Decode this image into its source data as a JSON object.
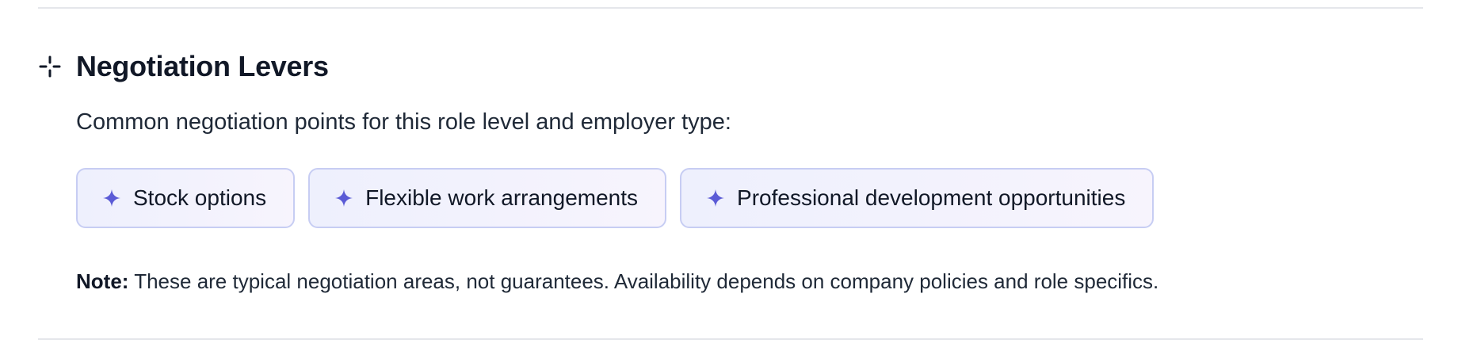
{
  "section": {
    "icon": "negotiation-levers-icon",
    "title": "Negotiation Levers",
    "subtitle": "Common negotiation points for this role level and employer type:"
  },
  "levers": [
    {
      "label": "Stock options",
      "icon": "sparkle-icon"
    },
    {
      "label": "Flexible work arrangements",
      "icon": "sparkle-icon"
    },
    {
      "label": "Professional development opportunities",
      "icon": "sparkle-icon"
    }
  ],
  "note": {
    "label": "Note:",
    "text": "These are typical negotiation areas, not guarantees. Availability depends on company policies and role specifics."
  },
  "colors": {
    "accent": "#5b5bd6",
    "chip_border": "#c7cdf3",
    "chip_bg": "#eef0fd",
    "text": "#111827",
    "divider": "#e5e7eb"
  }
}
